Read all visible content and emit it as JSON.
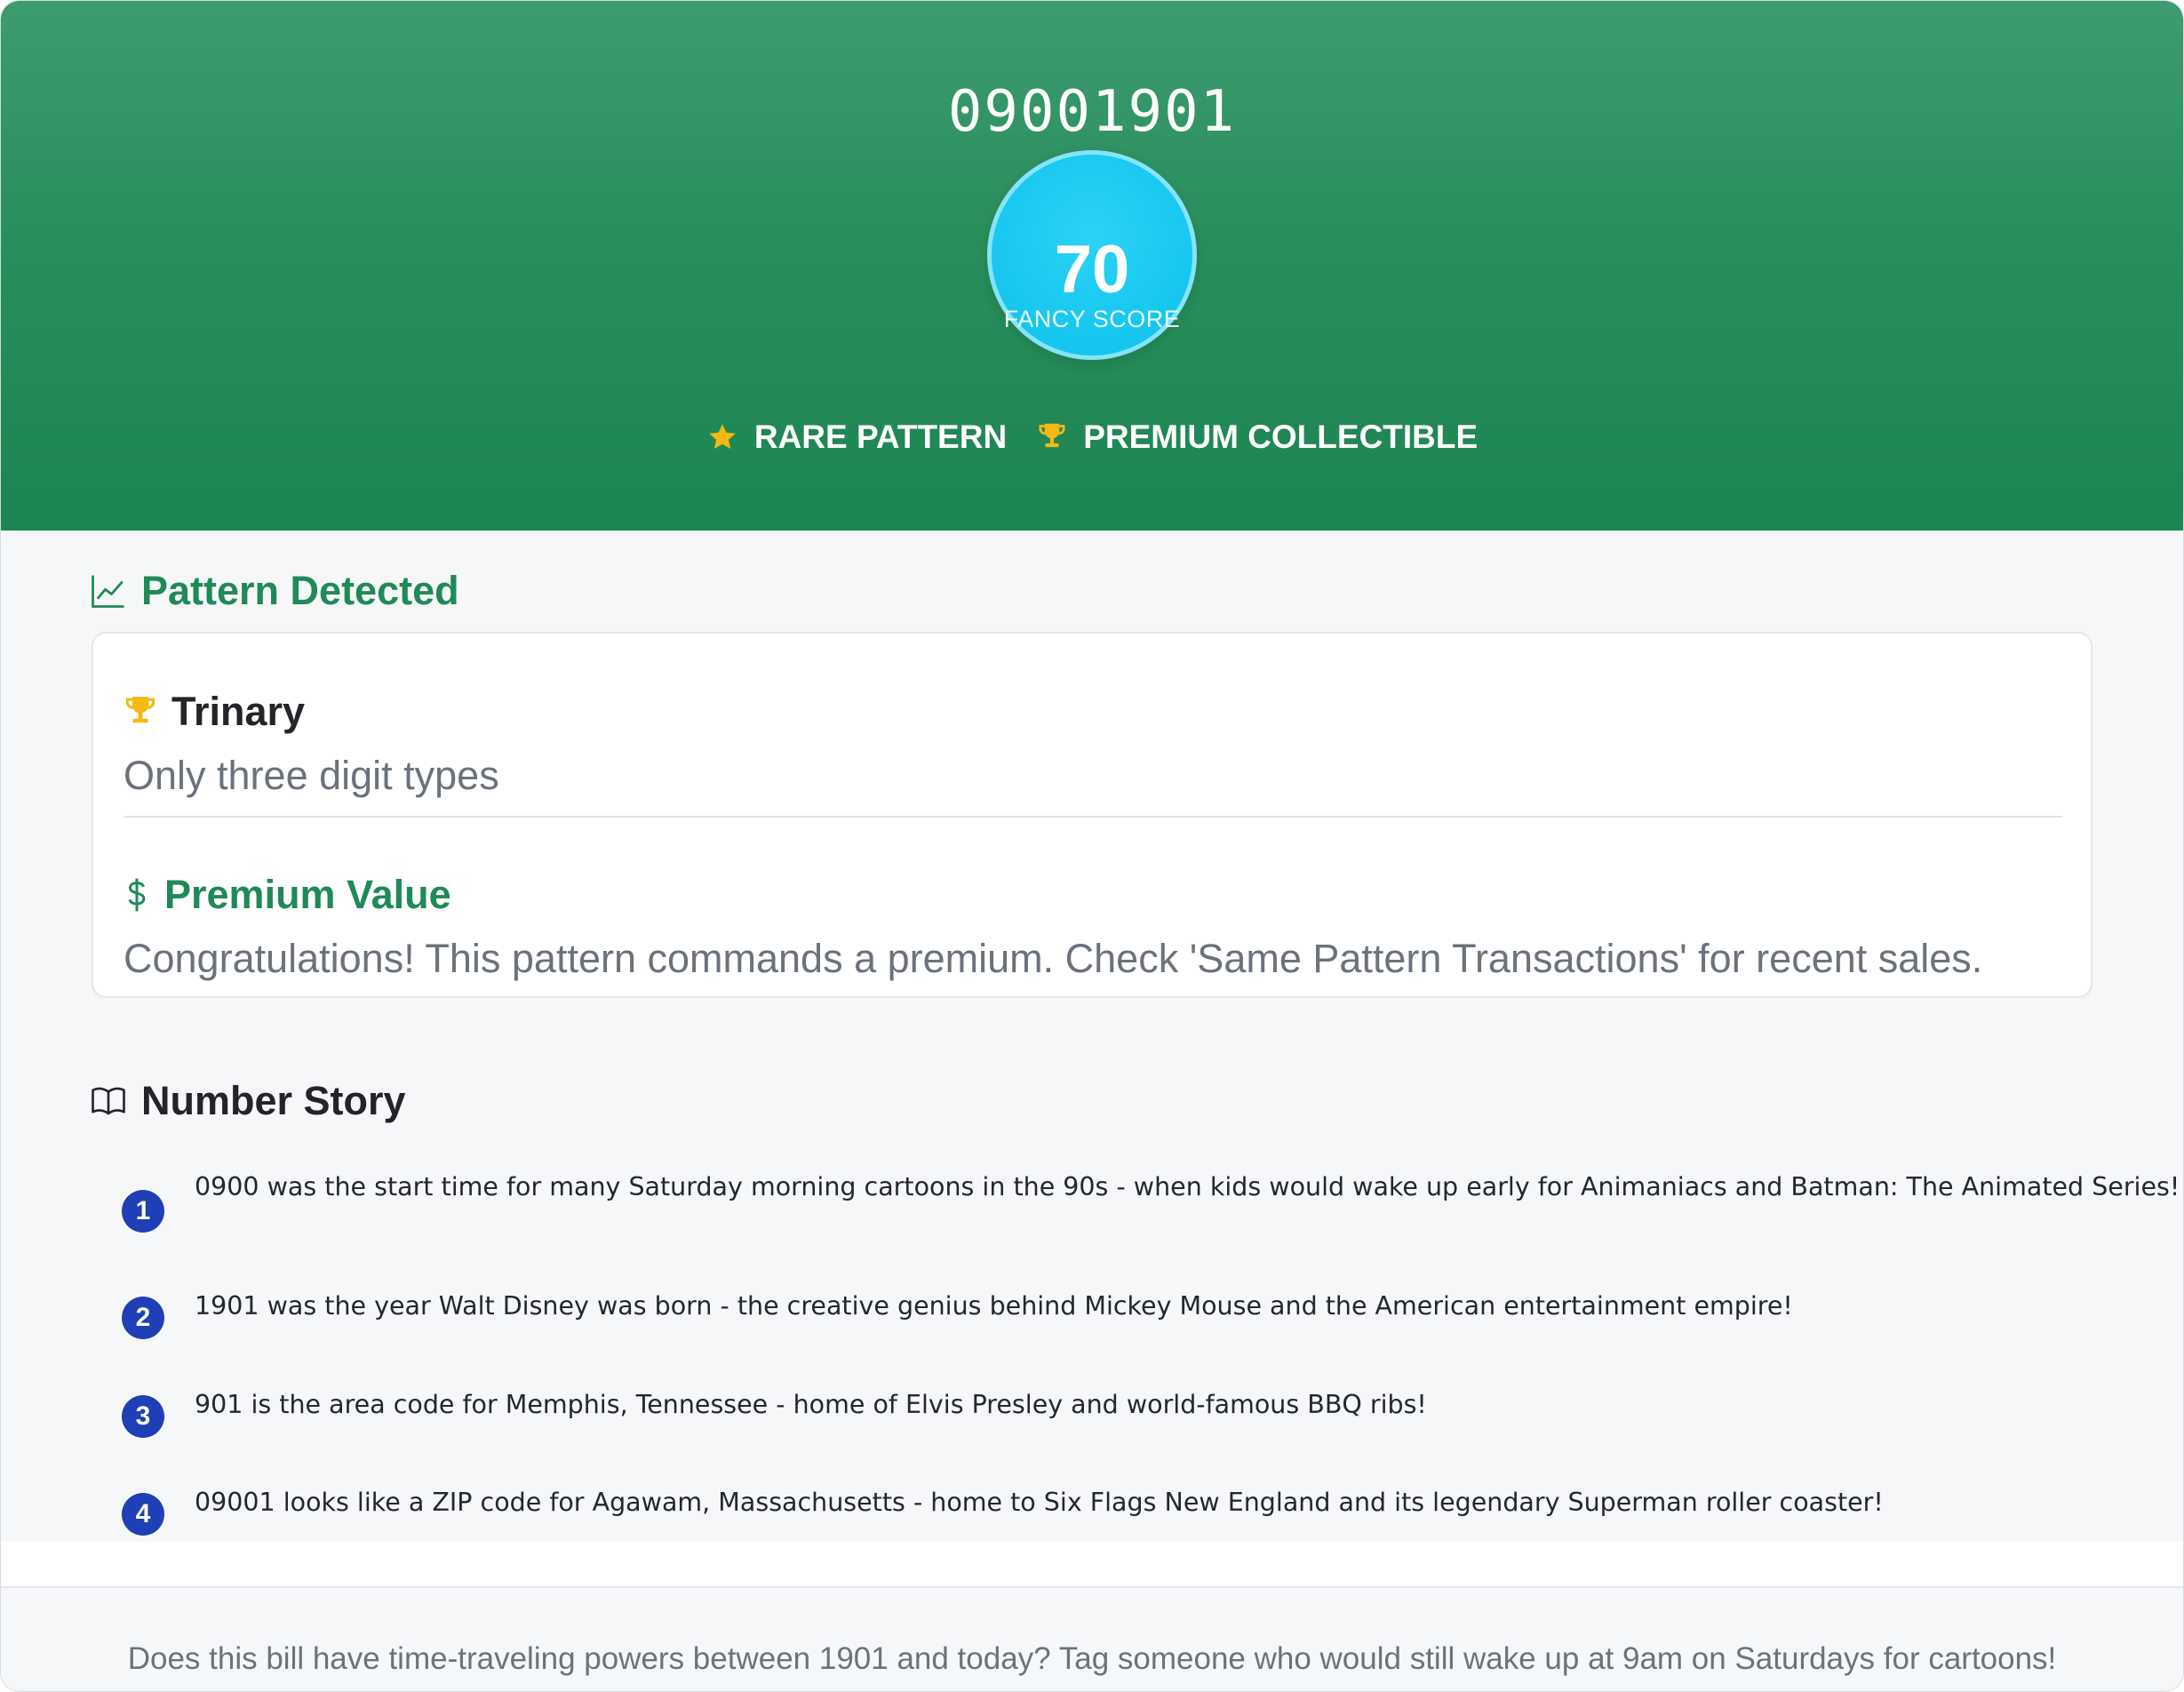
{
  "header": {
    "bill_number": "09001901",
    "score_value": "70",
    "score_label": "FANCY SCORE",
    "badges": [
      {
        "icon": "star-icon",
        "label": "RARE PATTERN"
      },
      {
        "icon": "trophy-icon",
        "label": "PREMIUM COLLECTIBLE"
      }
    ]
  },
  "pattern_section": {
    "title": "Pattern Detected",
    "icon": "line-chart-icon",
    "items": [
      {
        "icon": "trophy-icon",
        "title": "Trinary",
        "description": "Only three digit types"
      },
      {
        "icon": "dollar-icon",
        "title": "Premium Value",
        "description": "Congratulations! This pattern commands a premium. Check 'Same Pattern Transactions' for recent sales."
      }
    ]
  },
  "story_section": {
    "title": "Number Story",
    "icon": "book-icon",
    "items": [
      {
        "number": "1",
        "text": "0900 was the start time for many Saturday morning cartoons in the 90s - when kids would wake up early for Animaniacs and Batman: The Animated Series!"
      },
      {
        "number": "2",
        "text": "1901 was the year Walt Disney was born - the creative genius behind Mickey Mouse and the American entertainment empire!"
      },
      {
        "number": "3",
        "text": "901 is the area code for Memphis, Tennessee - home of Elvis Presley and world-famous BBQ ribs!"
      },
      {
        "number": "4",
        "text": "09001 looks like a ZIP code for Agawam, Massachusetts - home to Six Flags New England and its legendary Superman roller coaster!"
      }
    ]
  },
  "footer": {
    "text": "Does this bill have time-traveling powers between 1901 and today? Tag someone who would still wake up at 9am on Saturdays for cartoons!"
  },
  "colors": {
    "header_green": "#1c8551",
    "accent_green": "#1f8a57",
    "score_cyan": "#16c6ef",
    "badge_gold": "#f5b90f",
    "story_number_blue": "#1f3fb6"
  }
}
